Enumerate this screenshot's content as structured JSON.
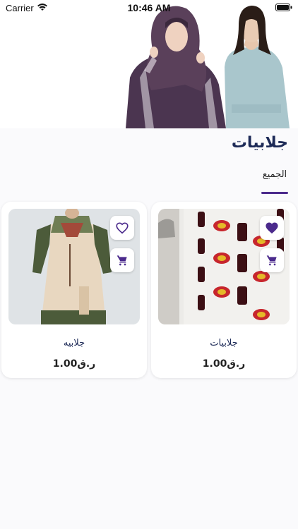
{
  "status_bar": {
    "carrier": "Carrier",
    "time": "10:46 AM"
  },
  "page": {
    "title": "جلابيات"
  },
  "tabs": [
    {
      "label": "الجميع",
      "selected": true
    }
  ],
  "products": [
    {
      "name": "جلابيات",
      "price": "1.00ر.ق",
      "favorited": true,
      "image_desc": "printed-fabric"
    },
    {
      "name": "جلابيه",
      "price": "1.00ر.ق",
      "favorited": false,
      "image_desc": "embroidered-dress"
    }
  ],
  "colors": {
    "accent": "#4b2a8c",
    "title": "#1d2a57"
  }
}
